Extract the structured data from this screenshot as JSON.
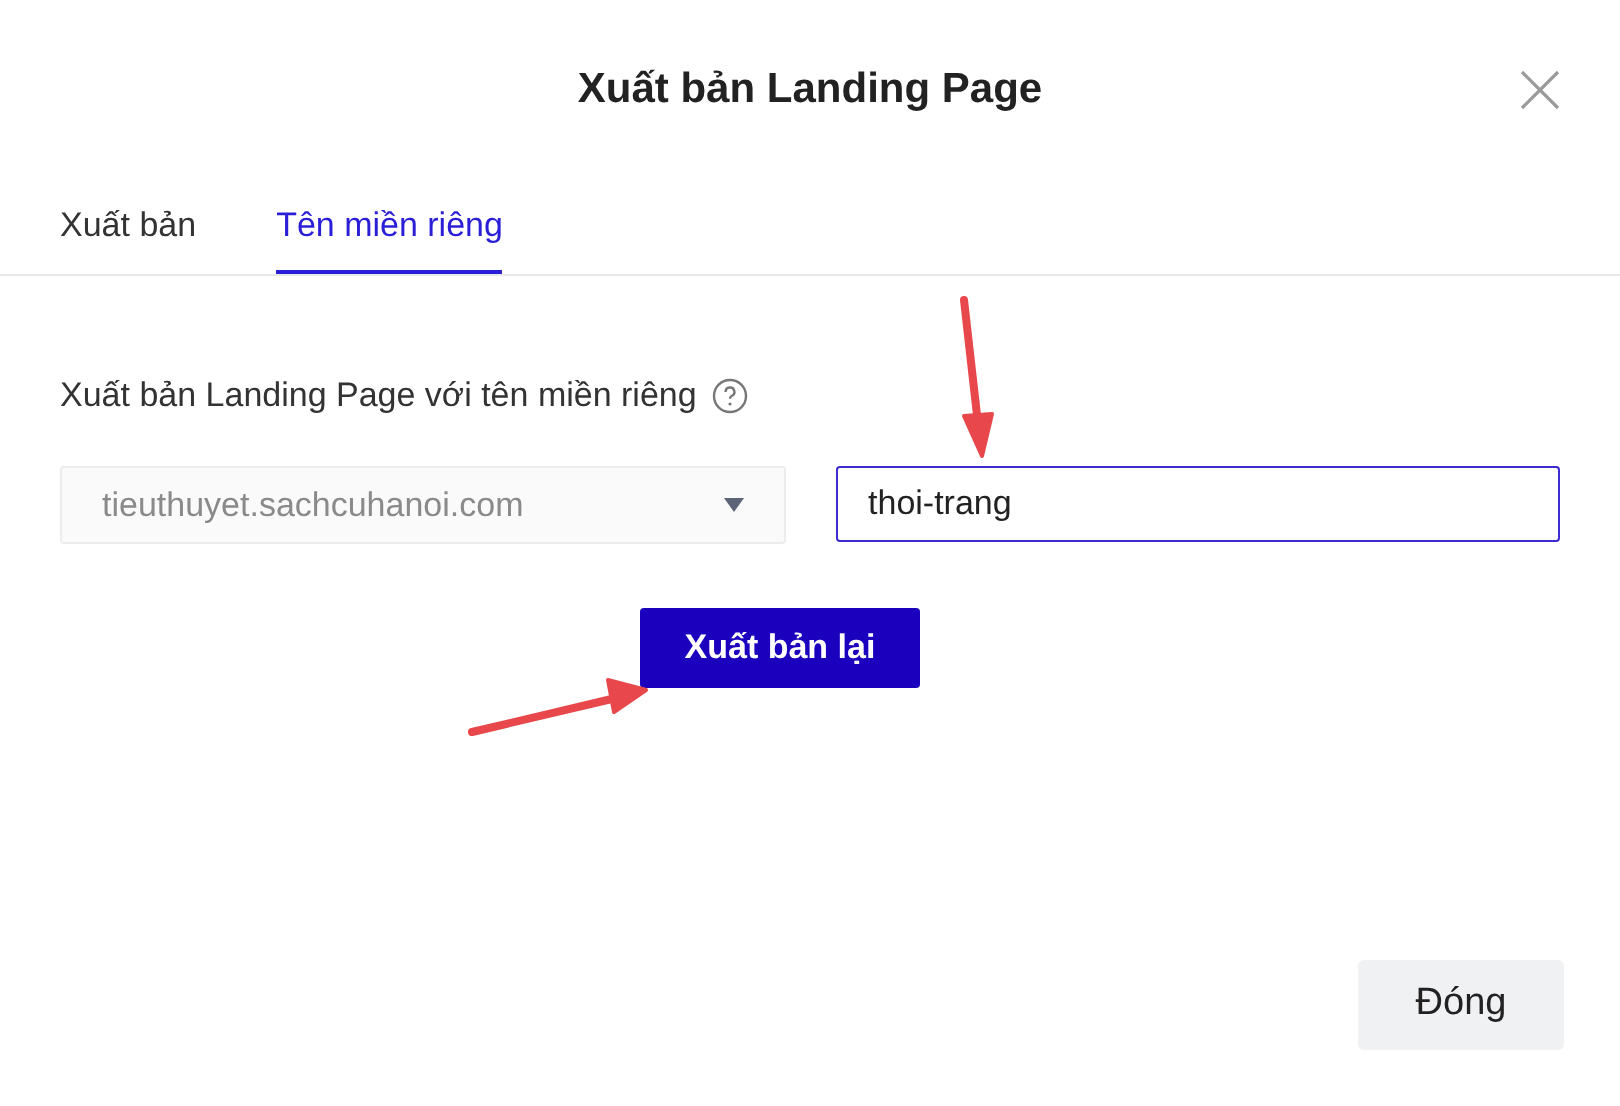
{
  "dialog": {
    "title": "Xuất bản Landing Page"
  },
  "tabs": [
    {
      "label": "Xuất bản",
      "selected": false
    },
    {
      "label": "Tên miền riêng",
      "selected": true
    }
  ],
  "form": {
    "label": "Xuất bản Landing Page với tên miền riêng",
    "domain_select": {
      "value": "tieuthuyet.sachcuhanoi.com"
    },
    "path_field": {
      "value": "thoi-trang"
    },
    "submit_button": "Xuất bản lại"
  },
  "footer": {
    "close_button": "Đóng"
  }
}
